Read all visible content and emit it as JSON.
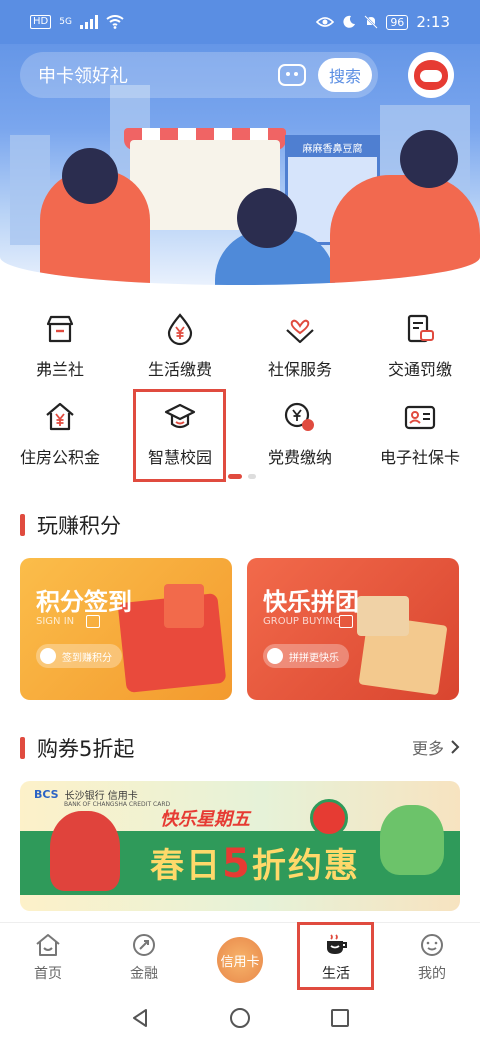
{
  "status_bar": {
    "network": "HD",
    "signal_type": "5G",
    "battery": "96",
    "time": "2:13"
  },
  "header": {
    "search_placeholder": "申卡领好礼",
    "search_button": "搜索",
    "stall_sign": "麻麻香鼻豆腐"
  },
  "services": [
    {
      "label": "弗兰社",
      "icon": "store-icon"
    },
    {
      "label": "生活缴费",
      "icon": "yuan-drop-icon"
    },
    {
      "label": "社保服务",
      "icon": "heart-hands-icon"
    },
    {
      "label": "交通罚缴",
      "icon": "traffic-ticket-icon"
    },
    {
      "label": "住房公积金",
      "icon": "house-yuan-icon"
    },
    {
      "label": "智慧校园",
      "icon": "graduation-cap-icon"
    },
    {
      "label": "党费缴纳",
      "icon": "party-fee-icon"
    },
    {
      "label": "电子社保卡",
      "icon": "id-card-icon"
    }
  ],
  "points_section": {
    "title": "玩赚积分",
    "cards": [
      {
        "title": "积分签到",
        "subtitle": "SIGN IN",
        "button": "签到赚积分",
        "color": "#f6a93b"
      },
      {
        "title": "快乐拼团",
        "subtitle": "GROUP BUYING",
        "button": "拼拼更快乐",
        "color": "#e2583a"
      }
    ]
  },
  "coupon_section": {
    "title": "购券5折起",
    "more": "更多",
    "banner": {
      "bank_logo": "BCS",
      "bank_name": "长沙银行 信用卡",
      "bank_name_en": "BANK OF CHANGSHA  CREDIT CARD",
      "slogan": "快乐星期五",
      "headline_pre": "春日",
      "headline_num": "5",
      "headline_post": "折约惠"
    }
  },
  "tabbar": [
    {
      "label": "首页",
      "icon": "home-icon"
    },
    {
      "label": "金融",
      "icon": "finance-icon"
    },
    {
      "label": "信用卡",
      "icon": "credit-card-coin-icon"
    },
    {
      "label": "生活",
      "icon": "coffee-cup-icon",
      "active": true
    },
    {
      "label": "我的",
      "icon": "profile-face-icon"
    }
  ],
  "colors": {
    "accent": "#e04b3f",
    "header_blue": "#5a8ee3"
  }
}
